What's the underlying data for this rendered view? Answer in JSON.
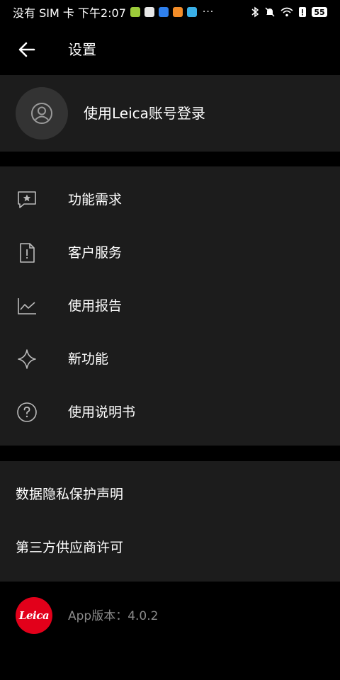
{
  "status_bar": {
    "left_text": "没有 SIM 卡 下午2:07",
    "more": "···",
    "battery": "55"
  },
  "app_bar": {
    "title": "设置"
  },
  "account": {
    "login_label": "使用Leica账号登录"
  },
  "menu": {
    "items": [
      {
        "label": "功能需求",
        "icon": "feedback-star-icon"
      },
      {
        "label": "客户服务",
        "icon": "document-alert-icon"
      },
      {
        "label": "使用报告",
        "icon": "chart-icon"
      },
      {
        "label": "新功能",
        "icon": "sparkle-icon"
      },
      {
        "label": "使用说明书",
        "icon": "help-circle-icon"
      }
    ]
  },
  "legal": {
    "items": [
      {
        "label": "数据隐私保护声明"
      },
      {
        "label": "第三方供应商许可"
      }
    ]
  },
  "footer": {
    "logo_text": "Leica",
    "version": "App版本：4.0.2"
  },
  "colors": {
    "background": "#000000",
    "card": "#1c1c1c",
    "avatar_bg": "#333333",
    "brand_red": "#e2001a",
    "muted_text": "#8a8a8a"
  }
}
